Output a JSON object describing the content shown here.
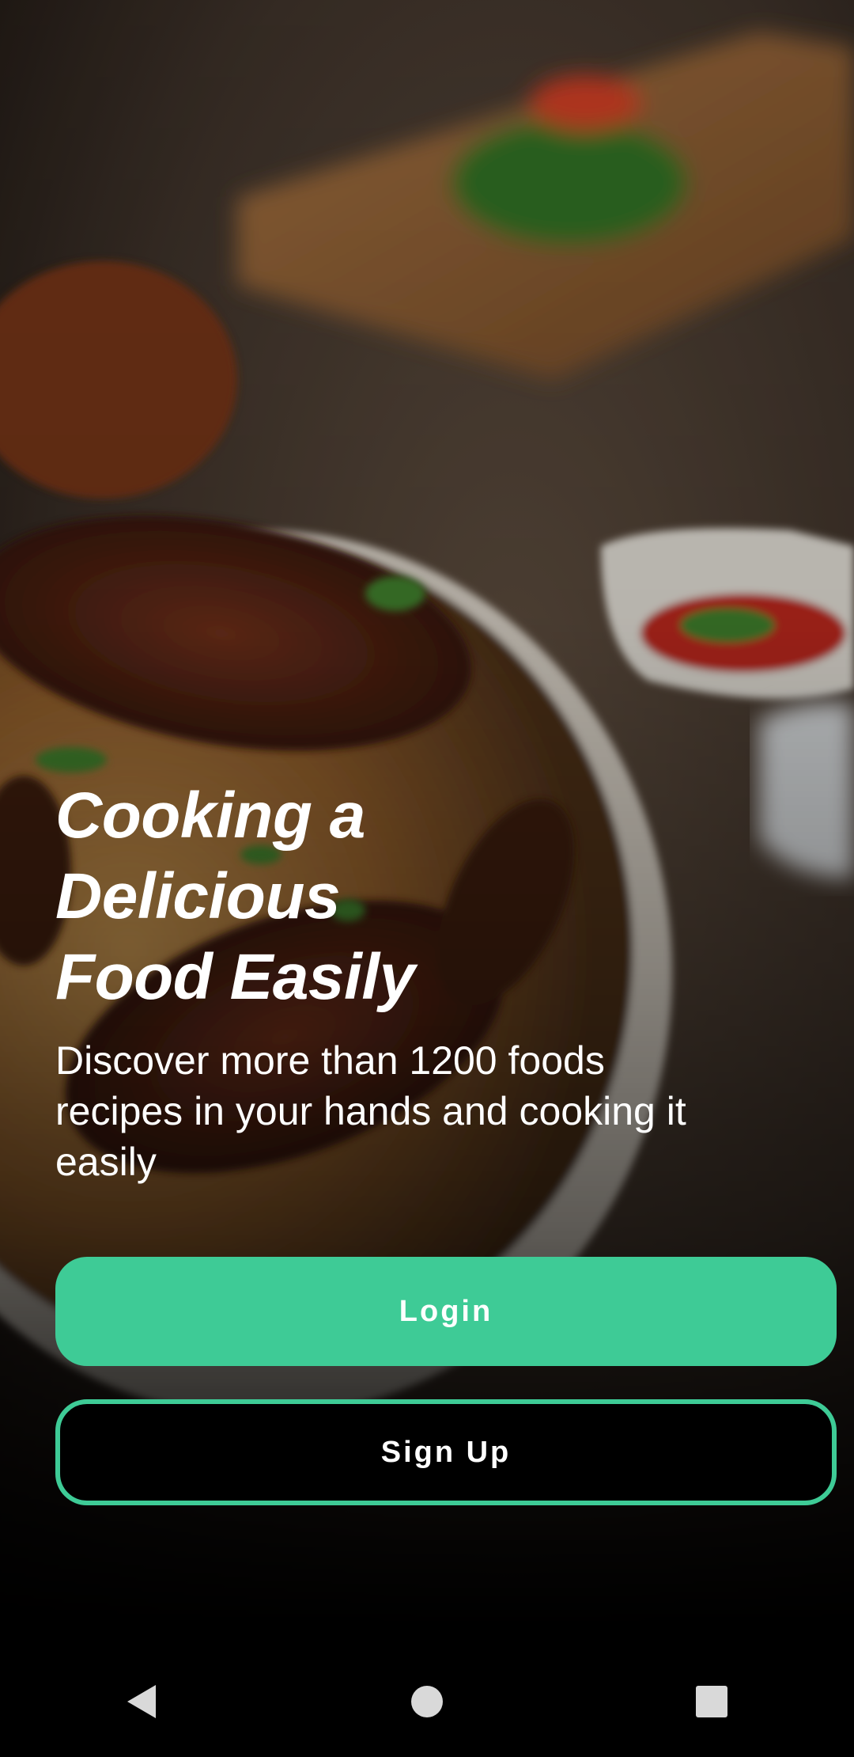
{
  "hero": {
    "headline": "Cooking a Delicious Food Easily",
    "description": "Discover more than 1200 foods recipes in your hands and cooking it easily"
  },
  "actions": {
    "login_label": "Login",
    "signup_label": "Sign Up"
  },
  "nav_bar": {
    "back_icon": "back-triangle-icon",
    "home_icon": "home-circle-icon",
    "recents_icon": "recents-square-icon"
  },
  "colors": {
    "accent": "#3ecb96",
    "background": "#000000",
    "text": "#ffffff"
  }
}
